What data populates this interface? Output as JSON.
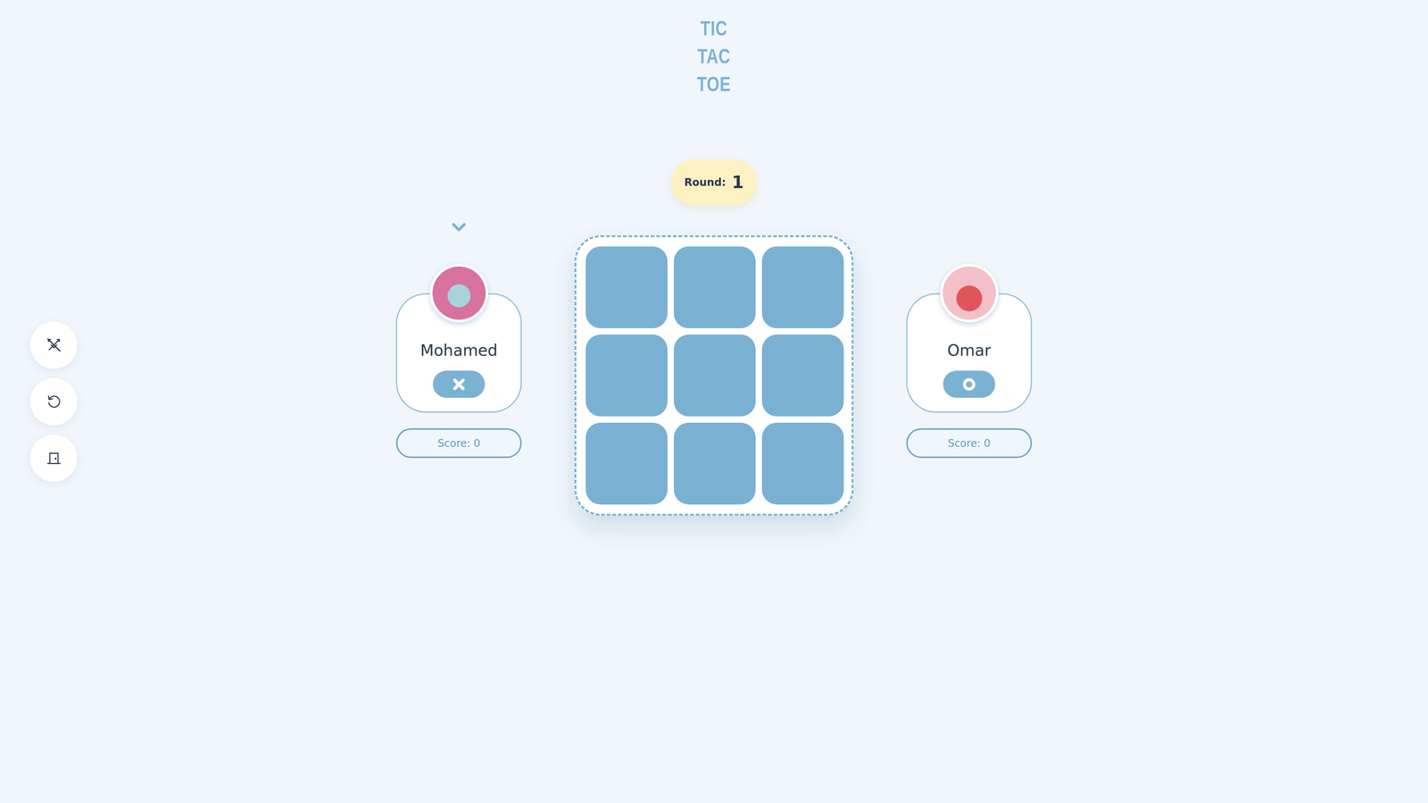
{
  "title": [
    "TIC",
    "TAC",
    "TOE"
  ],
  "round": {
    "label": "Round:",
    "value": "1"
  },
  "toolbar": [
    {
      "kind": "swords"
    },
    {
      "kind": "restart"
    },
    {
      "kind": "exit"
    }
  ],
  "players": [
    {
      "name": "Mohamed",
      "kind": "x",
      "score": "Score: 0",
      "turn": true
    },
    {
      "name": "Omar",
      "kind": "o",
      "score": "Score: 0",
      "turn": false
    }
  ],
  "board": {
    "cells": [
      {
        "mark": ""
      },
      {
        "mark": ""
      },
      {
        "mark": ""
      },
      {
        "mark": ""
      },
      {
        "mark": ""
      },
      {
        "mark": ""
      },
      {
        "mark": ""
      },
      {
        "mark": ""
      },
      {
        "mark": ""
      }
    ]
  }
}
